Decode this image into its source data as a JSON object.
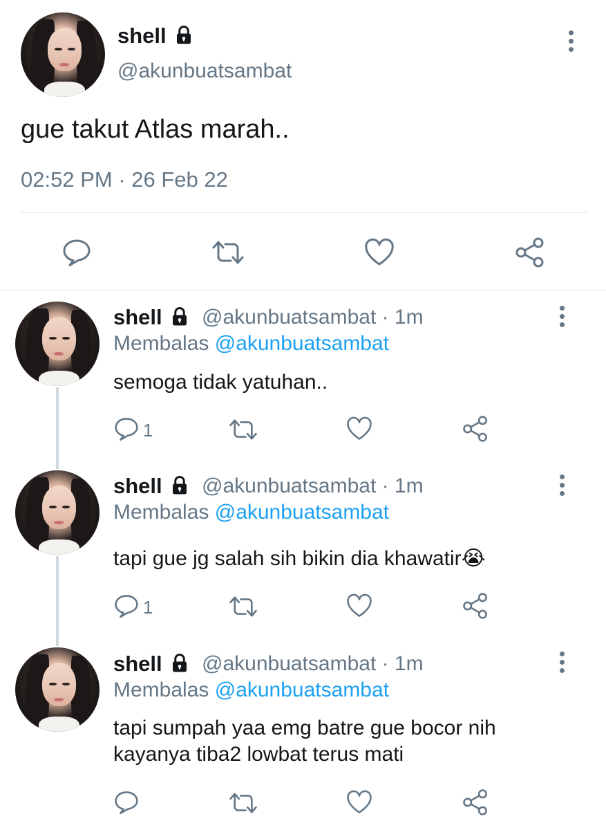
{
  "main_tweet": {
    "display_name": "shell",
    "handle": "@akunbuatsambat",
    "text": "gue takut Atlas marah..",
    "timestamp": "02:52 PM · 26 Feb 22"
  },
  "replies": [
    {
      "display_name": "shell",
      "handle_time": "@akunbuatsambat · 1m",
      "replying_label": "Membalas",
      "replying_to": "@akunbuatsambat",
      "text_lines": [
        "semoga tidak yatuhan.."
      ],
      "reply_count": "1"
    },
    {
      "display_name": "shell",
      "handle_time": "@akunbuatsambat · 1m",
      "replying_label": "Membalas",
      "replying_to": "@akunbuatsambat",
      "text_lines": [
        "tapi gue jg salah sih bikin dia khawatir😭"
      ],
      "reply_count": "1"
    },
    {
      "display_name": "shell",
      "handle_time": "@akunbuatsambat · 1m",
      "replying_label": "Membalas",
      "replying_to": "@akunbuatsambat",
      "text_lines": [
        "tapi sumpah yaa emg batre gue bocor nih",
        "kayanya tiba2 lowbat terus mati"
      ],
      "reply_count": ""
    }
  ],
  "icons": {
    "reply": "reply-bubble-icon",
    "retweet": "retweet-icon",
    "like": "heart-icon",
    "share": "share-icon",
    "lock": "lock-icon",
    "more": "more-vertical-icon"
  },
  "colors": {
    "text": "#14171a",
    "secondary": "#657786",
    "link": "#1da1f2",
    "divider": "#e1e8ed"
  }
}
